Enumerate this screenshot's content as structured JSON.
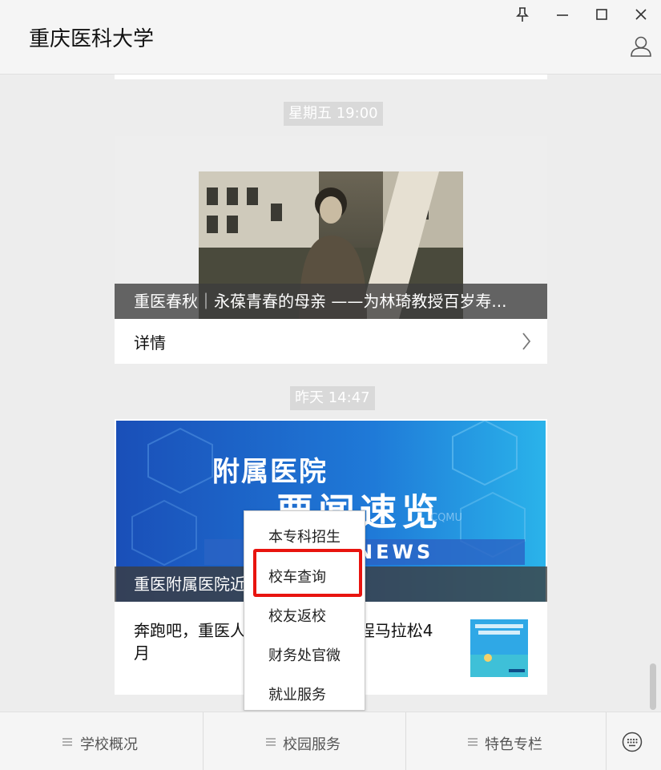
{
  "app_title": "重庆医科大学",
  "window_controls": {
    "pin_icon": "pin-icon",
    "minimize_icon": "minimize-icon",
    "maximize_icon": "maximize-icon",
    "close_icon": "close-icon"
  },
  "messages": [
    {
      "time": "星期五 19:00",
      "title": "重医春秋｜永葆青春的母亲 ——为林琦教授百岁寿...",
      "detail": "详情"
    },
    {
      "time": "昨天 14:47",
      "title": "重医附属医院近",
      "banner_line1": "附属医院",
      "banner_line2": "要闻速览",
      "banner_en": "NEWS",
      "banner_mark": "CQMU",
      "body": "奔跑吧，重医人｜“全球校友”半程马拉松4月"
    }
  ],
  "popup_menu": {
    "items": [
      "本专科招生",
      "校车查询",
      "校友返校",
      "财务处官微",
      "就业服务"
    ],
    "highlighted": "校车查询"
  },
  "bottom_tabs": [
    {
      "label": "学校概况"
    },
    {
      "label": "校园服务"
    },
    {
      "label": "特色专栏"
    }
  ],
  "keyboard_icon": "keyboard-icon",
  "colors": {
    "highlight": "#e8140f",
    "banner_blue": "#1a5bbf"
  }
}
